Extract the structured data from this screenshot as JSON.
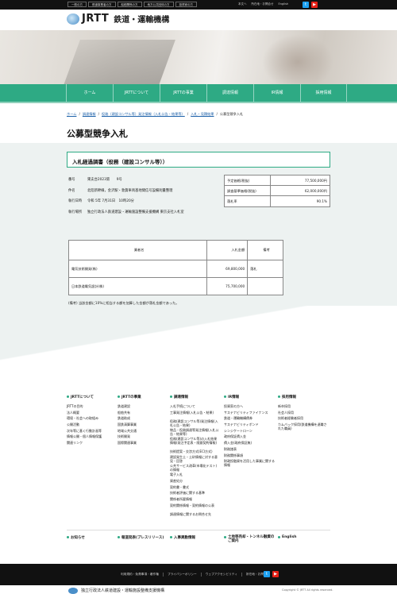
{
  "topbar": {
    "links": [
      "一般の方",
      "鉄道事業者の方",
      "船舶関係の方",
      "地方公共団体の方",
      "投資家の方"
    ],
    "util": [
      "本文へ",
      "所在地・お問合せ",
      "English"
    ]
  },
  "header": {
    "logo_text": "JRTT",
    "logo_jp": "鉄道・運輸機構"
  },
  "nav": [
    "ホーム",
    "JRTTについて",
    "JRTTの事業",
    "調達情報",
    "IR情報",
    "採用情報"
  ],
  "breadcrumb": {
    "items": [
      "ホーム",
      "調達情報",
      "役務（建設コンサル等）発注情報（入札公告・結果等）",
      "入札・見積結果"
    ],
    "current": "公募型競争入札"
  },
  "page_title": "公募型競争入札",
  "card_title": "入札経過調書（役務（建設コンサル等））",
  "info": [
    {
      "k": "番号",
      "v": "東支台2023第　　9号"
    },
    {
      "k": "件名",
      "v": "北陸新幹線，金沢駅・敦賀車両基地間信号設備則量整理"
    },
    {
      "k": "執行日時",
      "v": "令和 5年 7月31日　10時20分"
    },
    {
      "k": "執行場所",
      "v": "独立行政法人鉄道建設・運輸施設整備支援機構 東京支社入札室"
    }
  ],
  "price": [
    {
      "k": "予定価格(税抜)",
      "v": "77,500,000円"
    },
    {
      "k": "調査基準価格(税抜)",
      "v": "62,000,000円"
    },
    {
      "k": "落札率",
      "v": "90.1%"
    }
  ],
  "bids": {
    "headers": [
      "業者名",
      "入札金額",
      "備考"
    ],
    "rows": [
      {
        "name": "電気技術開発(株)",
        "amount": "69,800,000",
        "note": "落札"
      },
      {
        "name": "日本鉄道電気設計(株)",
        "amount": "75,700,000",
        "note": ""
      }
    ]
  },
  "note": "(備考) 当該金額に10%に相当する額を加算した金額が落札金額であった。",
  "footer_cols": [
    {
      "title": "JRTTについて",
      "items": [
        "JRTTの目的",
        "法人概要",
        "環境・社会への取組み",
        "公開活動",
        "次年等に基く行動計画等",
        "情報公開・個人情報保護",
        "関連リンク"
      ]
    },
    {
      "title": "JRTTの事業",
      "items": [
        "鉄道建設",
        "船舶共有",
        "鉄道助成",
        "国鉄清算事業",
        "地域公共交通",
        "技術開発",
        "国際関連事業"
      ]
    },
    {
      "title": "調達情報",
      "items": [
        "入札手続について",
        "工事発注情報(入札公告・結果)",
        "役務(建設コンサル等)発注情報(入札公告・結果)",
        "物品・役務調達等発注情報(入札公告・結果等)",
        "役務(建設コンサル等)の入札結果情報(発注予定表・随意契約情報)",
        "技術提案・交渉方式(ECI方式)",
        "建設発生土・土砂情報に対する意見・回答",
        "公共サービス改革(市場化テスト)の情報",
        "電子入札",
        "資産処分",
        "契約書・書式",
        "技術者評価に関する基準",
        "関係者所要情報",
        "契約関係情報・契約情報の公表",
        "調達情報に関するお問合せ先"
      ]
    },
    {
      "title": "IR情報",
      "items": [
        "投資家の方へ",
        "サステナビリティファイナンス",
        "鉄道・運輸機構債券",
        "サステナビリティボンド",
        "シンジケートローン",
        "政府保証債入金",
        "債入金(政府保証無)",
        "財務諸表",
        "財務関係事項",
        "財政投融資を活用した事業に関する情報"
      ]
    },
    {
      "title": "採用情報",
      "items": [
        "新卒採用",
        "社会人採用",
        "技術者経験者採用",
        "カムバック採用(鉄道機構を退職された職員)"
      ]
    }
  ],
  "footer_row2": [
    "お知らせ",
    "報道発表(プレスリリース)",
    "入事異動情報",
    "土地等売却・トンネル融資のご案内",
    "English"
  ],
  "footer_links": [
    "利用規約・免責事項・著作権",
    "プライバシーポリシー",
    "ウェブアクセシビリティ",
    "所在地・お問合せ"
  ],
  "footer_bottom": {
    "org": "独立行政法人鉄道建設・運輸施設整備支援機構",
    "right": "Copyright © JRTT All rights reserved."
  },
  "colors": {
    "accent": "#2eaa84",
    "twitter": "#1da1f2",
    "youtube": "#e62117"
  }
}
